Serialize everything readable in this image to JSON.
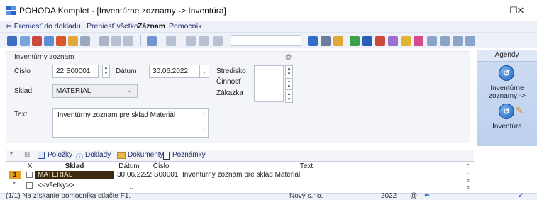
{
  "window": {
    "title": "POHODA Komplet - [Inventúrne zoznamy -> Inventúra]",
    "minimize_glyph": "—",
    "maximize_glyph": "☐",
    "close_glyph": "✕"
  },
  "menu": {
    "items": [
      {
        "label": "⇦ Preniesť do dokladu",
        "bold": false
      },
      {
        "label": "Preniesť všetko",
        "bold": false
      },
      {
        "label": "Záznam",
        "bold": true
      },
      {
        "label": "Pomocník",
        "bold": false
      }
    ]
  },
  "form": {
    "section_title": "Inventúrny zoznam",
    "section_mark": "@",
    "cislo_label": "Číslo",
    "cislo_value": "22IS00001",
    "datum_label": "Dátum",
    "datum_value": "30.06.2022",
    "sklad_label": "Sklad",
    "sklad_value": "MATERIÁL",
    "text_label": "Text",
    "text_value": "Inventúrny zoznam pre sklad Materiál",
    "stredisko_label": "Stredisko",
    "cinnost_label": "Činnosť",
    "zakazka_label": "Zákazka"
  },
  "agenda": {
    "header": "Agendy",
    "items": [
      {
        "label": "Inventúrne zoznamy ->",
        "icon": "agenda-circle-icon"
      },
      {
        "label": "Inventúra",
        "icon": "agenda-circle-pencil-icon"
      }
    ]
  },
  "tabs": [
    {
      "label": "Položky",
      "icon": "list-icon"
    },
    {
      "label": "Doklady",
      "icon": "info-icon"
    },
    {
      "label": "Dokumenty",
      "icon": "folder-icon"
    },
    {
      "label": "Poznámky",
      "icon": "note-icon"
    }
  ],
  "grid": {
    "columns": [
      "X",
      "Sklad",
      "Dátum",
      "Číslo",
      "Text"
    ],
    "rows": [
      {
        "index": "1",
        "sklad": "MATERIÁL",
        "datum": "30.06.22",
        "cislo": "22IS00001",
        "text": "Inventúrny zoznam pre sklad Materiál"
      }
    ],
    "filter_row_value": "<<všetky>>",
    "filter_row_dots": "..",
    "new_row_marker": "*"
  },
  "status": {
    "hint": "(1/1) Na získanie pomocníka stlačte F1.",
    "company": "Nový s.r.o.",
    "year": "2022",
    "at": "@"
  },
  "colors": {
    "accent": "#1d5fb9",
    "row_indicator": "#e2a01b",
    "selected_row": "#3b2a10"
  }
}
